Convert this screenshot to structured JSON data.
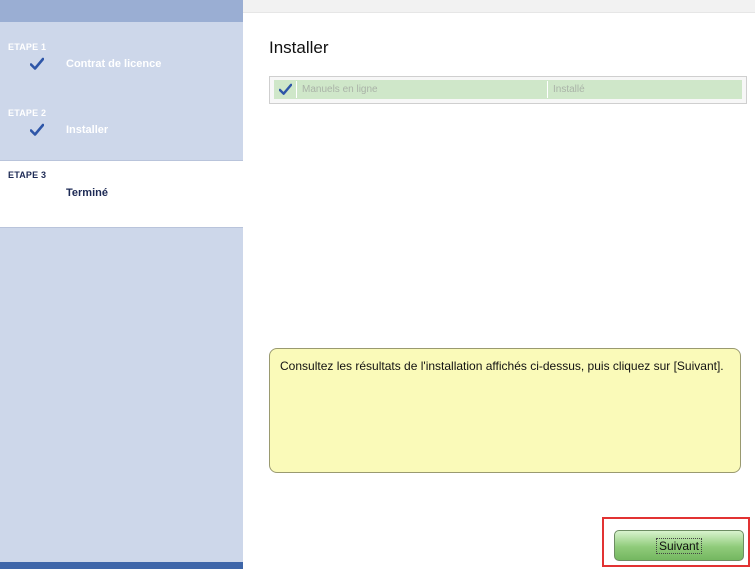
{
  "sidebar": {
    "steps": [
      {
        "number": "ETAPE 1",
        "label": "Contrat de licence",
        "state": "done",
        "icon": "check-icon"
      },
      {
        "number": "ETAPE 2",
        "label": "Installer",
        "state": "done",
        "icon": "check-icon"
      },
      {
        "number": "ETAPE 3",
        "label": "Terminé",
        "state": "current"
      }
    ]
  },
  "main": {
    "title": "Installer",
    "install_table": {
      "rows": [
        {
          "icon": "check-icon",
          "name": "Manuels en ligne",
          "status": "Installé"
        }
      ]
    },
    "message": "Consultez les résultats de l'installation affichés ci-dessus, puis cliquez sur [Suivant]."
  },
  "footer": {
    "next_label": "Suivant"
  },
  "colors": {
    "sidebar_bg": "#cdd7ea",
    "sidebar_accent": "#3e66a9",
    "row_bg": "#cfe7c9",
    "message_bg": "#fafab9",
    "button_green": "#8fcb7a",
    "highlight_red": "#e23232"
  }
}
